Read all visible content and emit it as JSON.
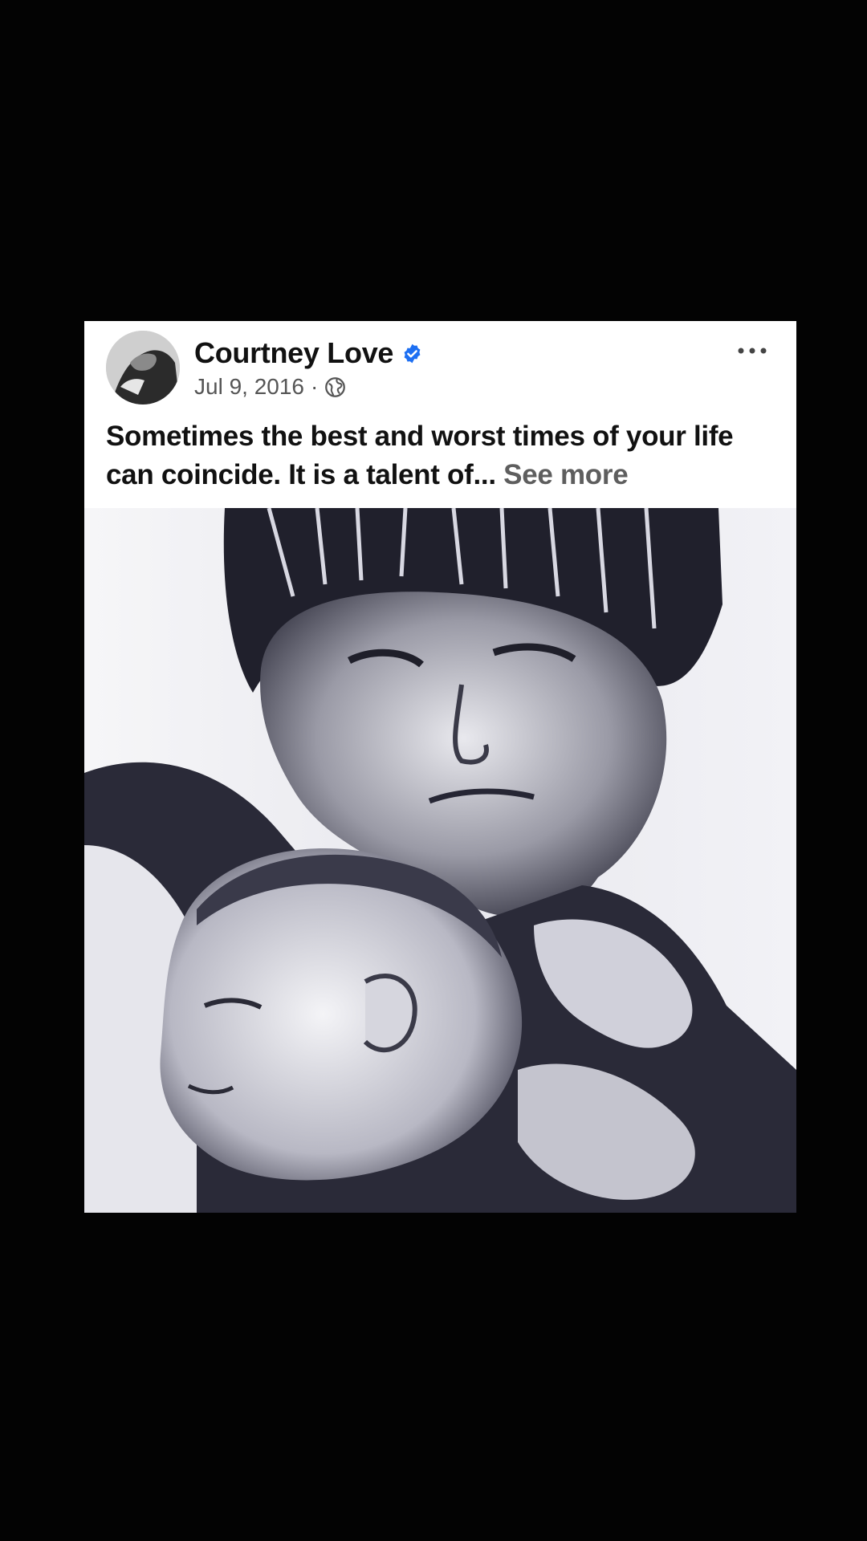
{
  "post": {
    "author": "Courtney Love",
    "date": "Jul 9, 2016",
    "separator": "·",
    "audience_icon": "globe-icon",
    "verified_icon": "verified-badge-icon",
    "more_icon": "more-options-icon",
    "caption_text": "Sometimes the best and worst times of your life can coincide. It is a talent of... ",
    "see_more_label": "See more",
    "photo_alt": "Black and white photo"
  },
  "colors": {
    "background": "#030303",
    "card": "#ffffff",
    "verified": "#1d6ff2",
    "meta_text": "#555555",
    "see_more": "#5e5e5e"
  }
}
